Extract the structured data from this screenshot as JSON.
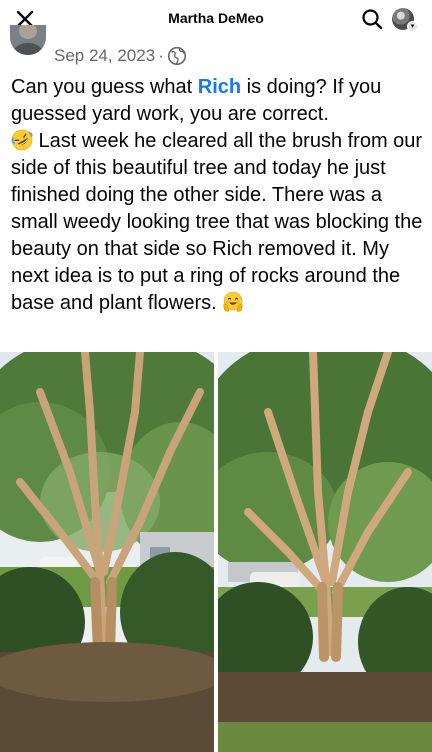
{
  "header": {
    "title": "Martha DeMeo",
    "close_icon": "close-icon",
    "search_icon": "search-icon",
    "profile_icon": "profile-avatar"
  },
  "post": {
    "date": "Sep 24, 2023",
    "separator": "·",
    "audience_icon": "globe-icon",
    "text_before_mention": "Can you guess what ",
    "mention": "Rich",
    "text_after_mention": " is doing? If you guessed yard work, you are correct.",
    "text_para2": " Last week he cleared all the brush from our side of this beautiful tree and today he just finished doing the other side.  There was a small weedy looking tree that was blocking the beauty on that side so Rich removed it. My next idea is to put a ring of rocks around the base and plant flowers. ",
    "emoji_1": "rolling-on-floor-laughing-emoji",
    "emoji_2": "smiling-face-with-open-hands-emoji"
  },
  "photos": [
    {
      "name": "crepe-myrtle-before-photo"
    },
    {
      "name": "crepe-myrtle-after-photo"
    }
  ],
  "colors": {
    "mention": "#1877f2",
    "meta_text": "#65676b",
    "text": "#050505"
  }
}
